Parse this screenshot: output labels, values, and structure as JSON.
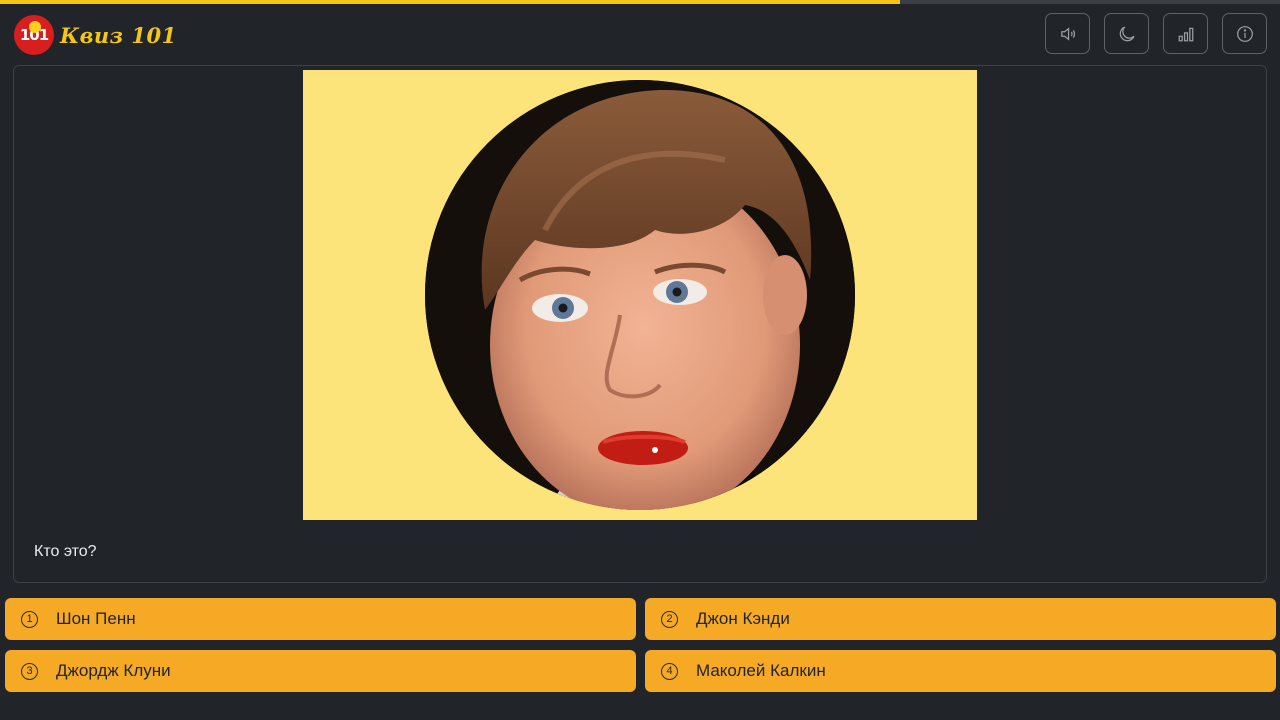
{
  "progress": {
    "fraction": 0.703,
    "color": "#f5c518"
  },
  "logo": {
    "badge": "101",
    "text": "Квиз 101",
    "alt_icon": "quiz-101-logo-icon"
  },
  "toolbar": {
    "buttons": [
      {
        "icon": "speaker-icon"
      },
      {
        "icon": "moon-icon"
      },
      {
        "icon": "bar-chart-icon"
      },
      {
        "icon": "info-icon"
      }
    ]
  },
  "question": {
    "text": "Кто это?",
    "image": "circular-portrait-photo"
  },
  "answers": [
    {
      "number": "1",
      "label": "Шон Пенн"
    },
    {
      "number": "2",
      "label": "Джон Кэнди"
    },
    {
      "number": "3",
      "label": "Джордж Клуни"
    },
    {
      "number": "4",
      "label": "Маколей Калкин"
    }
  ],
  "colors": {
    "background": "#212529",
    "accent": "#f6a925",
    "photo_bg": "#fde47a"
  }
}
